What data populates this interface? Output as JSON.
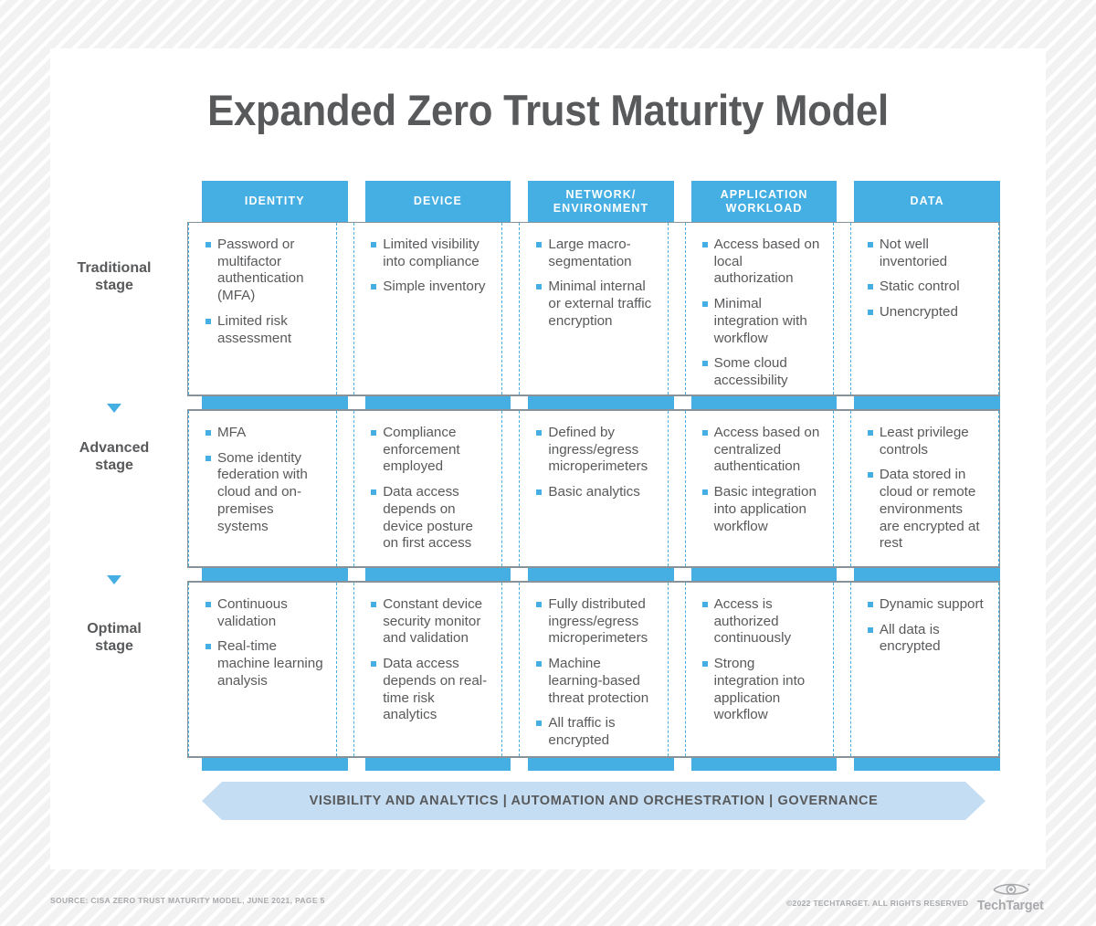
{
  "title": "Expanded Zero Trust Maturity Model",
  "columns": [
    {
      "label": "IDENTITY",
      "lines": [
        "IDENTITY"
      ]
    },
    {
      "label": "DEVICE",
      "lines": [
        "DEVICE"
      ]
    },
    {
      "label": "NETWORK/ENVIRONMENT",
      "lines": [
        "NETWORK/",
        "ENVIRONMENT"
      ]
    },
    {
      "label": "APPLICATION WORKLOAD",
      "lines": [
        "APPLICATION",
        "WORKLOAD"
      ]
    },
    {
      "label": "DATA",
      "lines": [
        "DATA"
      ]
    }
  ],
  "stages": [
    {
      "label_lines": [
        "Traditional",
        "stage"
      ],
      "cells": [
        [
          "Password or multifactor authentication (MFA)",
          "Limited risk assessment"
        ],
        [
          "Limited visibility into compliance",
          "Simple inventory"
        ],
        [
          "Large macro-segmentation",
          "Minimal internal or external traffic encryption"
        ],
        [
          "Access based on local authorization",
          "Minimal integration with workflow",
          "Some cloud accessibility"
        ],
        [
          "Not well inventoried",
          "Static control",
          "Unencrypted"
        ]
      ]
    },
    {
      "label_lines": [
        "Advanced",
        "stage"
      ],
      "cells": [
        [
          "MFA",
          "Some identity federation with cloud and on-premises systems"
        ],
        [
          "Compliance enforcement employed",
          "Data access depends on device posture on first access"
        ],
        [
          "Defined by ingress/egress microperimeters",
          "Basic analytics"
        ],
        [
          "Access based on centralized authentication",
          "Basic integration into application workflow"
        ],
        [
          "Least privilege controls",
          "Data stored in cloud or remote environments are encrypted at rest"
        ]
      ]
    },
    {
      "label_lines": [
        "Optimal",
        "stage"
      ],
      "cells": [
        [
          "Continuous validation",
          "Real-time machine learning analysis"
        ],
        [
          "Constant device security monitor and validation",
          "Data access depends on real-time risk analytics"
        ],
        [
          "Fully distributed ingress/egress microperimeters",
          "Machine learning-based threat protection",
          "All traffic is encrypted"
        ],
        [
          "Access is authorized continuously",
          "Strong integration into application workflow"
        ],
        [
          "Dynamic support",
          "All data is encrypted"
        ]
      ]
    }
  ],
  "banner": {
    "text": "VISIBILITY AND ANALYTICS  |  AUTOMATION AND ORCHESTRATION  |  GOVERNANCE"
  },
  "footer": {
    "source": "SOURCE: CISA ZERO TRUST MATURITY MODEL, JUNE 2021, PAGE 5",
    "copyright": "©2022 TECHTARGET. ALL RIGHTS RESERVED",
    "logo_word": "TechTarget",
    "logo_icon": "eye-icon"
  },
  "colors": {
    "accent_blue": "#45aee2",
    "banner_blue": "#c5ddf2",
    "text_gray": "#58595b",
    "border_gray": "#8a9299",
    "muted_gray": "#a7a9ac"
  }
}
